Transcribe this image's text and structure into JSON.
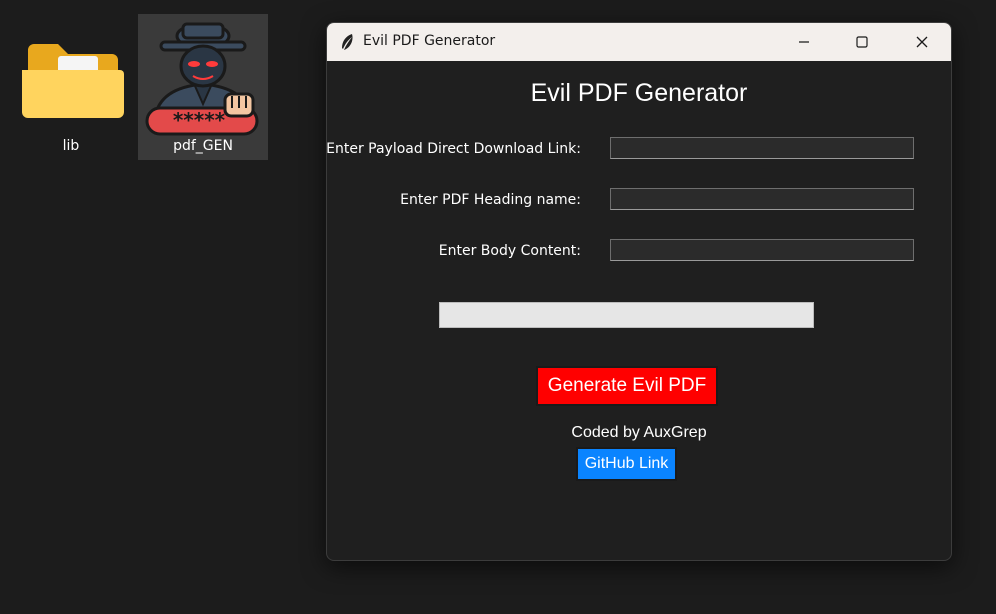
{
  "desktop": {
    "icons": [
      {
        "label": "lib",
        "icon": "folder-icon"
      },
      {
        "label": "pdf_GEN",
        "icon": "hacker-icon"
      }
    ],
    "hacker_badge_text": "*****"
  },
  "window": {
    "title": "Evil PDF Generator",
    "app_icon": "feather-icon",
    "controls": [
      "minimize-icon",
      "maximize-icon",
      "close-icon"
    ],
    "heading": "Evil PDF Generator",
    "fields": [
      {
        "label": "Enter Payload Direct Download Link:",
        "value": ""
      },
      {
        "label": "Enter PDF Heading name:",
        "value": ""
      },
      {
        "label": "Enter Body Content:",
        "value": ""
      }
    ],
    "progress": 0,
    "generate_label": "Generate Evil PDF",
    "credit": "Coded by AuxGrep",
    "github_label": "GitHub Link"
  },
  "colors": {
    "generate_button": "#ff0000",
    "github_button": "#0a84ff",
    "window_bg": "#1f1f1f",
    "desktop_bg": "#1c1c1c"
  }
}
